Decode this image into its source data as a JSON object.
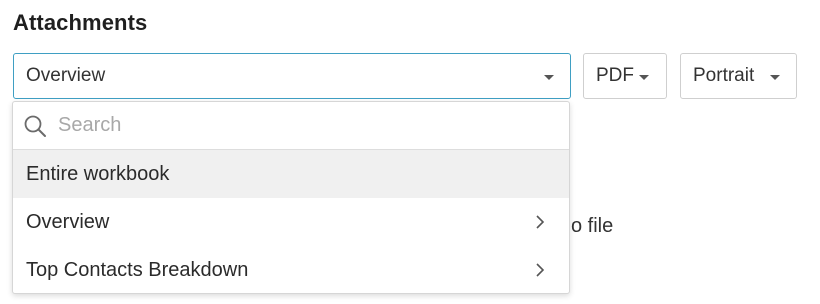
{
  "section": {
    "title": "Attachments"
  },
  "primary_select": {
    "value": "Overview"
  },
  "format_select": {
    "value": "PDF"
  },
  "orientation_select": {
    "value": "Portrait"
  },
  "background": {
    "partial_text": "o file"
  },
  "dropdown": {
    "search_placeholder": "Search",
    "search_value": "",
    "options": [
      {
        "label": "Entire workbook",
        "highlighted": true,
        "has_submenu": false
      },
      {
        "label": "Overview",
        "highlighted": false,
        "has_submenu": true
      },
      {
        "label": "Top Contacts Breakdown",
        "highlighted": false,
        "has_submenu": true
      }
    ]
  },
  "icons": {
    "search": "search-icon",
    "caret": "caret-down-icon",
    "submenu": "chevron-right-icon"
  },
  "colors": {
    "focus_border": "#3f9fc3",
    "highlight_bg": "#f0f0f0",
    "placeholder": "#a8a8a8"
  }
}
